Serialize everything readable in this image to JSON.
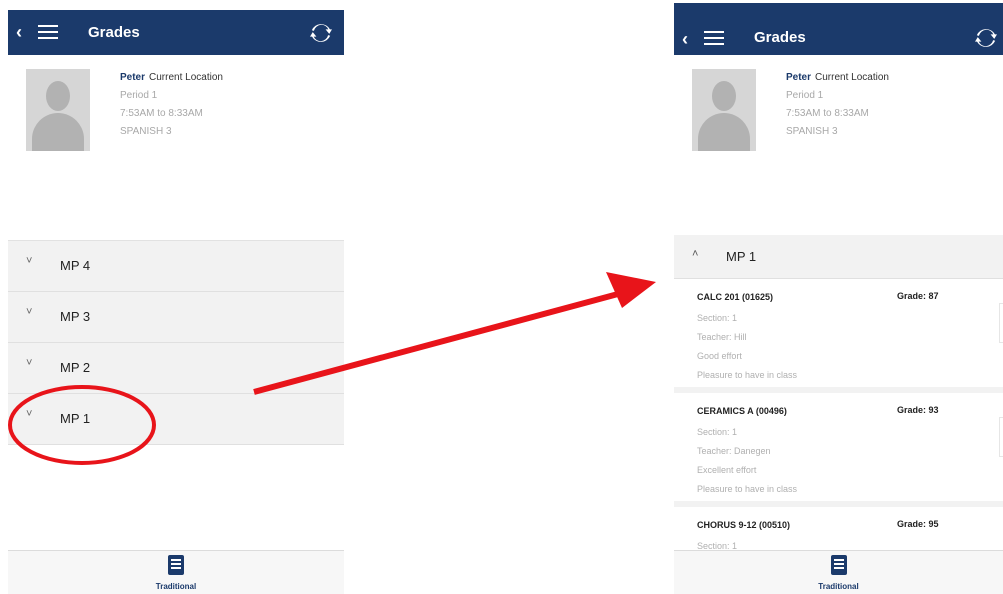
{
  "left_screen": {
    "header": {
      "back_icon": "chevron-left-icon",
      "menu_icon": "hamburger-menu-icon",
      "title": "Grades",
      "sync_icon": "refresh-icon"
    },
    "student": {
      "name": "Peter",
      "location_label": "Current Location",
      "period": "Period 1",
      "time": "7:53AM to 8:33AM",
      "course": "SPANISH 3"
    },
    "marking_periods": [
      {
        "label": "MP 4",
        "chevron": "˅"
      },
      {
        "label": "MP 3",
        "chevron": "˅"
      },
      {
        "label": "MP 2",
        "chevron": "˅"
      },
      {
        "label": "MP 1",
        "chevron": "˅"
      }
    ],
    "bottom_tab": {
      "label": "Traditional",
      "icon": "book-icon"
    }
  },
  "right_screen": {
    "header": {
      "back_icon": "chevron-left-icon",
      "menu_icon": "hamburger-menu-icon",
      "title": "Grades",
      "sync_icon": "refresh-icon"
    },
    "student": {
      "name": "Peter",
      "location_label": "Current Location",
      "period": "Period 1",
      "time": "7:53AM to 8:33AM",
      "course": "SPANISH 3"
    },
    "expanded_period": {
      "label": "MP 1",
      "chevron": "˄"
    },
    "courses": [
      {
        "name": "CALC 201 (01625)",
        "grade": "Grade: 87",
        "section": "Section: 1",
        "teacher": "Teacher: Hill",
        "comment1": "Good effort",
        "comment2": "Pleasure to have in class"
      },
      {
        "name": "CERAMICS A (00496)",
        "grade": "Grade: 93",
        "section": "Section: 1",
        "teacher": "Teacher: Danegen",
        "comment1": "Excellent effort",
        "comment2": "Pleasure to have in class"
      },
      {
        "name": "CHORUS 9-12 (00510)",
        "grade": "Grade: 95",
        "section": "Section: 1"
      }
    ],
    "bottom_tab": {
      "label": "Traditional",
      "icon": "book-icon"
    }
  },
  "annotation": {
    "circle_color": "#e8141a",
    "arrow_color": "#e8141a",
    "circled_item": "MP 1"
  },
  "colors": {
    "header_bg": "#1b3a6b",
    "row_bg": "#f2f2f2",
    "muted_text": "#a8a8a8"
  }
}
